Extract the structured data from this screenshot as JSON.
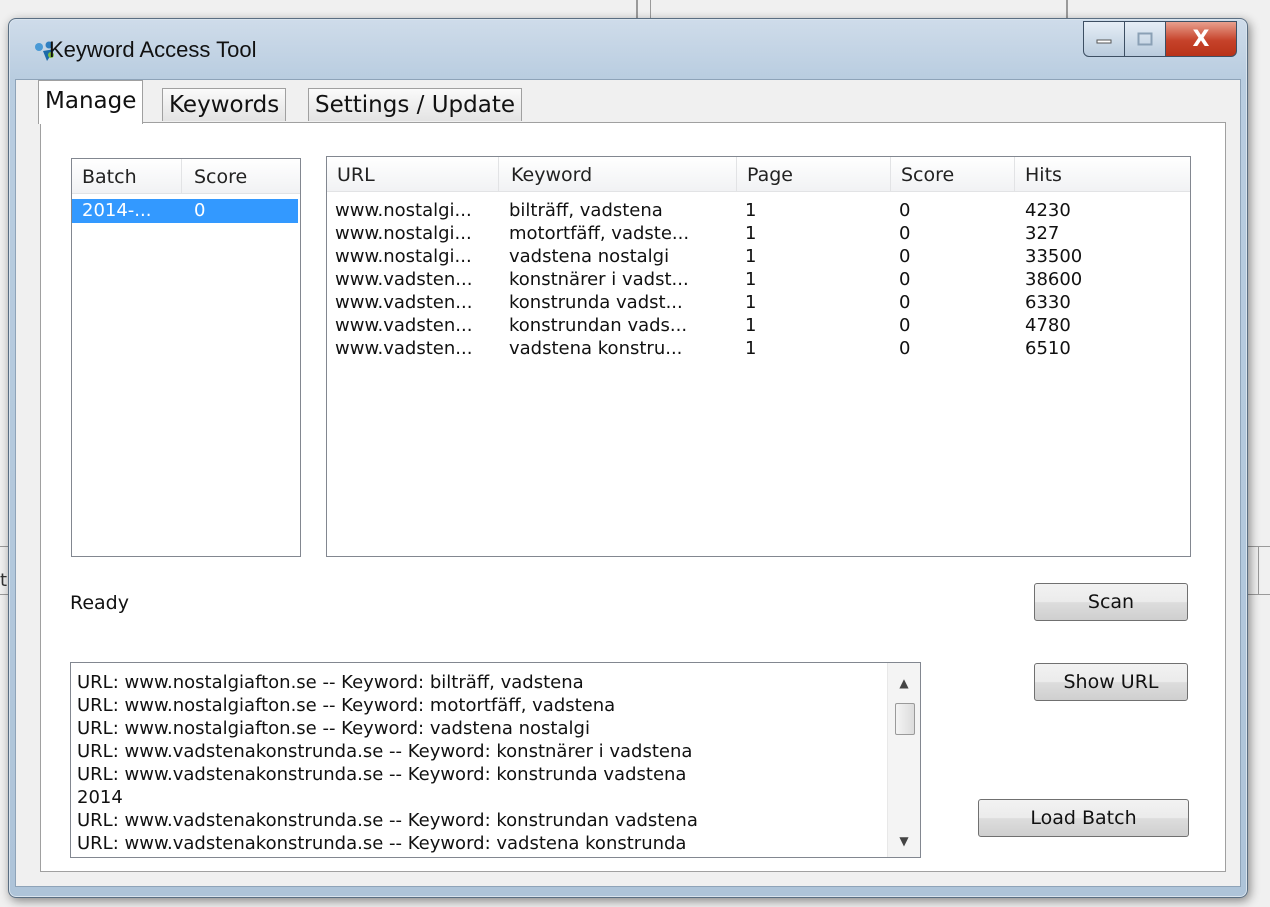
{
  "window": {
    "title": "Keyword Access Tool",
    "close_glyph": "X",
    "minimize_glyph": "▁",
    "maximize_glyph": "▭"
  },
  "background": {
    "edge_text": "ta"
  },
  "tabs": [
    {
      "label": "Manage",
      "active": true
    },
    {
      "label": "Keywords",
      "active": false
    },
    {
      "label": "Settings / Update",
      "active": false
    }
  ],
  "batch_list": {
    "columns": [
      "Batch",
      "Score"
    ],
    "rows": [
      {
        "batch": "2014-...",
        "score": "0",
        "selected": true
      }
    ]
  },
  "results_table": {
    "columns": [
      "URL",
      "Keyword",
      "Page",
      "Score",
      "Hits"
    ],
    "rows": [
      {
        "url": "www.nostalgi...",
        "keyword": "bilträff, vadstena",
        "page": "1",
        "score": "0",
        "hits": "4230"
      },
      {
        "url": "www.nostalgi...",
        "keyword": "motortfäff, vadste...",
        "page": "1",
        "score": "0",
        "hits": "327"
      },
      {
        "url": "www.nostalgi...",
        "keyword": "vadstena nostalgi",
        "page": "1",
        "score": "0",
        "hits": "33500"
      },
      {
        "url": "www.vadsten...",
        "keyword": "konstnärer i vadst...",
        "page": "1",
        "score": "0",
        "hits": "38600"
      },
      {
        "url": "www.vadsten...",
        "keyword": "konstrunda vadst...",
        "page": "1",
        "score": "0",
        "hits": "6330"
      },
      {
        "url": "www.vadsten...",
        "keyword": "konstrundan vads...",
        "page": "1",
        "score": "0",
        "hits": "4780"
      },
      {
        "url": "www.vadsten...",
        "keyword": "vadstena konstru...",
        "page": "1",
        "score": "0",
        "hits": "6510"
      }
    ]
  },
  "status_text": "Ready",
  "buttons": {
    "scan": "Scan",
    "show_url": "Show URL",
    "load_batch": "Load Batch"
  },
  "log": {
    "lines": [
      "URL: www.nostalgiafton.se -- Keyword: bilträff, vadstena",
      "URL: www.nostalgiafton.se -- Keyword: motortfäff, vadstena",
      "URL: www.nostalgiafton.se -- Keyword: vadstena nostalgi",
      "URL: www.vadstenakonstrunda.se -- Keyword: konstnärer i vadstena",
      "URL: www.vadstenakonstrunda.se -- Keyword: konstrunda vadstena",
      "2014",
      "URL: www.vadstenakonstrunda.se -- Keyword: konstrundan vadstena",
      "URL: www.vadstenakonstrunda.se -- Keyword: vadstena konstrunda"
    ],
    "scroll_up_glyph": "▲",
    "scroll_down_glyph": "▼"
  },
  "colors": {
    "selection": "#3399ff",
    "close_button": "#c6422a"
  }
}
